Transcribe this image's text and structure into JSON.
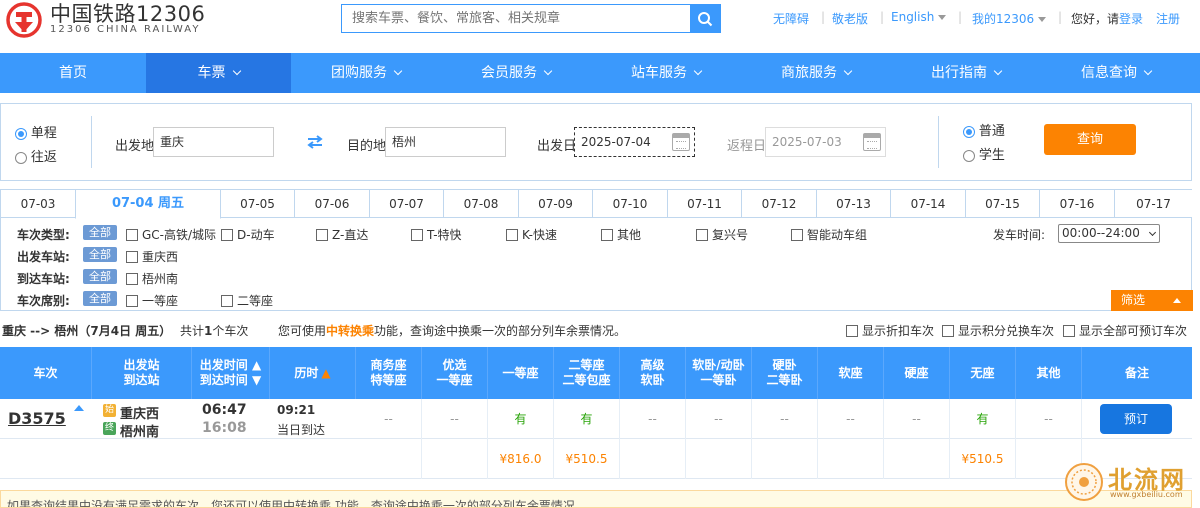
{
  "logo": {
    "cn": "中国铁路12306",
    "en": "12306 CHINA RAILWAY"
  },
  "search": {
    "placeholder": "搜索车票、餐饮、常旅客、相关规章"
  },
  "toplinks": {
    "accessibility": "无障碍",
    "elderly": "敬老版",
    "english": "English",
    "my12306": "我的12306",
    "greeting": "您好，请",
    "login": "登录",
    "register": "注册"
  },
  "nav": [
    {
      "label": "首页",
      "dropdown": false
    },
    {
      "label": "车票",
      "dropdown": true
    },
    {
      "label": "团购服务",
      "dropdown": true
    },
    {
      "label": "会员服务",
      "dropdown": true
    },
    {
      "label": "站车服务",
      "dropdown": true
    },
    {
      "label": "商旅服务",
      "dropdown": true
    },
    {
      "label": "出行指南",
      "dropdown": true
    },
    {
      "label": "信息查询",
      "dropdown": true
    }
  ],
  "query": {
    "oneway": "单程",
    "roundtrip": "往返",
    "from_label": "出发地",
    "from_value": "重庆",
    "to_label": "目的地",
    "to_value": "梧州",
    "depart_label": "出发日",
    "depart_value": "2025-07-04",
    "return_label": "返程日",
    "return_value": "2025-07-03",
    "normal": "普通",
    "student": "学生",
    "button": "查询"
  },
  "dates": [
    "07-03",
    "07-04 周五",
    "07-05",
    "07-06",
    "07-07",
    "07-08",
    "07-09",
    "07-10",
    "07-11",
    "07-12",
    "07-13",
    "07-14",
    "07-15",
    "07-16",
    "07-17"
  ],
  "filter": {
    "type_label": "车次类型:",
    "all": "全部",
    "types": [
      "GC-高铁/城际",
      "D-动车",
      "Z-直达",
      "T-特快",
      "K-快速",
      "其他",
      "复兴号",
      "智能动车组"
    ],
    "from_label": "出发车站:",
    "from_stations": [
      "重庆西"
    ],
    "to_label": "到达车站:",
    "to_stations": [
      "梧州南"
    ],
    "seat_label": "车次席别:",
    "seats": [
      "一等座",
      "二等座"
    ],
    "time_label": "发车时间:",
    "time_value": "00:00--24:00",
    "screen_button": "筛选"
  },
  "summary": {
    "route": "重庆 --> 梧州（7月4日  周五）",
    "count_pre": "共计",
    "count": "1",
    "count_post": "个车次",
    "tip_pre": "您可使用",
    "tip_link": "中转换乘",
    "tip_post": "功能，查询途中换乘一次的部分列车余票情况。",
    "opt1": "显示折扣车次",
    "opt2": "显示积分兑换车次",
    "opt3": "显示全部可预订车次"
  },
  "table": {
    "headers": [
      [
        "车次"
      ],
      [
        "出发站",
        "到达站"
      ],
      [
        "出发时间",
        "到达时间"
      ],
      [
        "历时"
      ],
      [
        "商务座",
        "特等座"
      ],
      [
        "优选",
        "一等座"
      ],
      [
        "一等座"
      ],
      [
        "二等座",
        "二等包座"
      ],
      [
        "高级",
        "软卧"
      ],
      [
        "软卧/动卧",
        "一等卧"
      ],
      [
        "硬卧",
        "二等卧"
      ],
      [
        "软座"
      ],
      [
        "硬座"
      ],
      [
        "无座"
      ],
      [
        "其他"
      ],
      [
        "备注"
      ]
    ],
    "train": {
      "number": "D3575",
      "from_badge": "始",
      "from": "重庆西",
      "to_badge": "终",
      "to": "梧州南",
      "dep_time": "06:47",
      "arr_time": "16:08",
      "duration": "09:21",
      "arrive_day": "当日到达",
      "seats": [
        "--",
        "--",
        "有",
        "有",
        "--",
        "--",
        "--",
        "--",
        "--",
        "有",
        "--"
      ],
      "prices": [
        "",
        "",
        "¥816.0",
        "¥510.5",
        "",
        "",
        "",
        "",
        "",
        "¥510.5",
        ""
      ],
      "book": "预订"
    }
  },
  "bottom_tip": "如果查询结果中没有满足需求的车次，您还可以使用中转换乘 功能，查询途中换乘一次的部分列车余票情况。",
  "watermark": {
    "text": "北流网",
    "url": "www.gxbeiliu.com"
  }
}
